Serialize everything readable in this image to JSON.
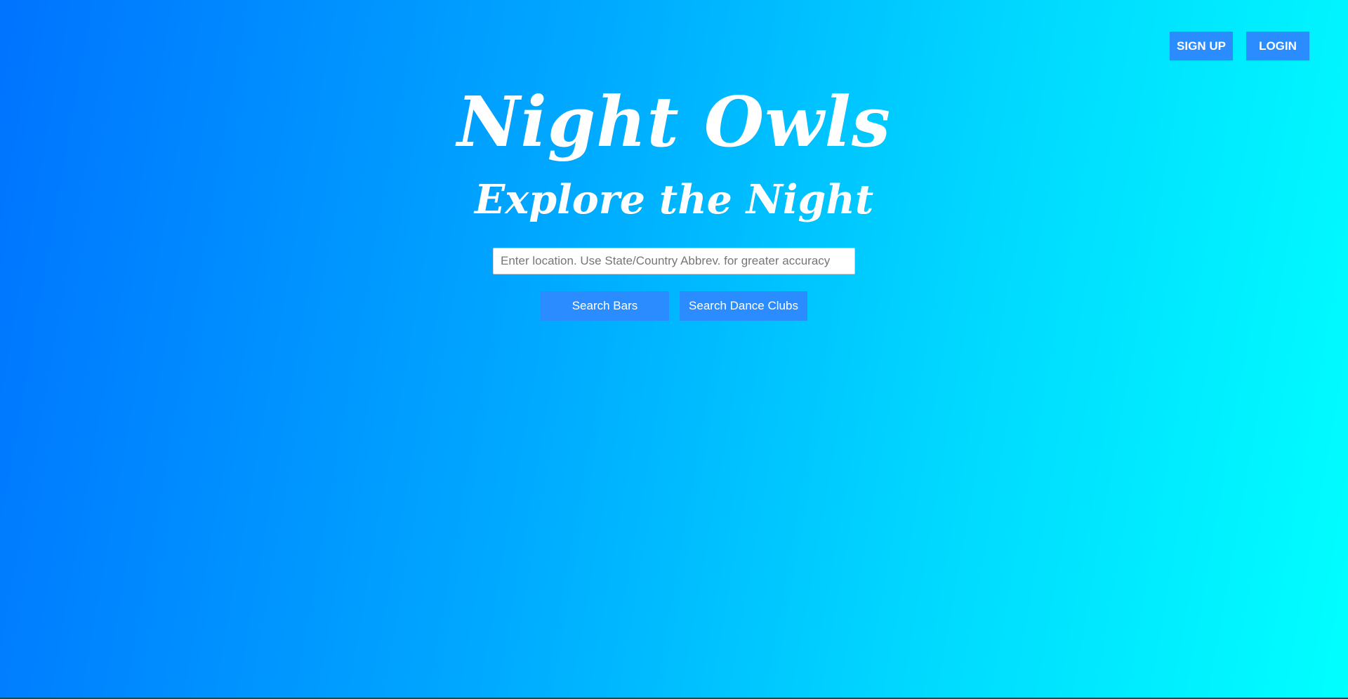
{
  "header": {
    "signup_label": "SIGN UP",
    "login_label": "LOGIN"
  },
  "hero": {
    "title": "Night Owls",
    "subtitle": "Explore the Night"
  },
  "search": {
    "placeholder": "Enter location. Use State/Country Abbrev. for greater accuracy",
    "value": "",
    "bars_label": "Search Bars",
    "clubs_label": "Search Dance Clubs"
  },
  "colors": {
    "gradient_start": "#0073ff",
    "gradient_end": "#00ffff",
    "button_bg": "#2a8cff",
    "text": "#ffffff"
  }
}
